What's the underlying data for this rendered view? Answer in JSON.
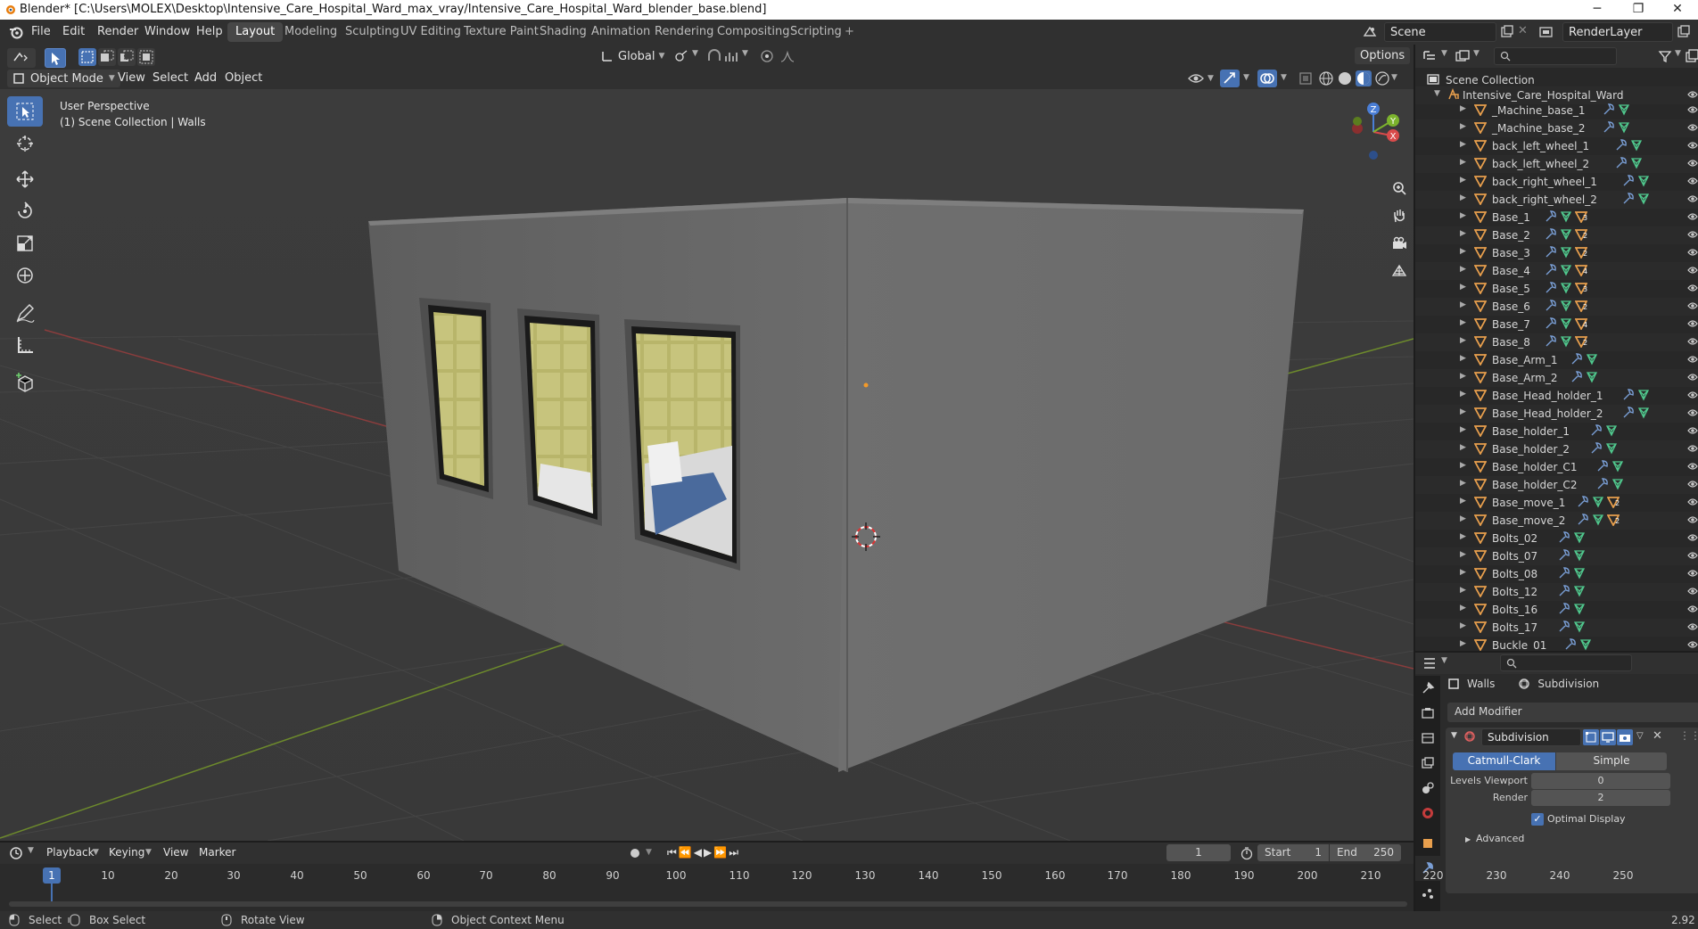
{
  "titlebar": {
    "title": "Blender* [C:\\Users\\MOLEX\\Desktop\\Intensive_Care_Hospital_Ward_max_vray/Intensive_Care_Hospital_Ward_blender_base.blend]",
    "minimize": "─",
    "maximize": "❐",
    "close": "✕"
  },
  "menus": [
    "File",
    "Edit",
    "Render",
    "Window",
    "Help"
  ],
  "workspaces": [
    "Layout",
    "Modeling",
    "Sculpting",
    "UV Editing",
    "Texture Paint",
    "Shading",
    "Animation",
    "Rendering",
    "Compositing",
    "Scripting"
  ],
  "active_workspace": "Layout",
  "add_workspace": "+",
  "scene": {
    "label": "Scene",
    "render_layer": "RenderLayer"
  },
  "viewport_header": {
    "mode": "Object Mode",
    "menus": [
      "View",
      "Select",
      "Add",
      "Object"
    ],
    "transform_orientation": "Global",
    "options": "Options"
  },
  "viewport": {
    "perspective": "User Perspective",
    "collection_info": "(1) Scene Collection | Walls"
  },
  "gizmo": {
    "x": "X",
    "y": "Y",
    "z": "Z"
  },
  "outliner": {
    "root": "Scene Collection",
    "collection": "Intensive_Care_Hospital_Ward",
    "items": [
      {
        "name": "_Machine_base_1",
        "badge": ""
      },
      {
        "name": "_Machine_base_2",
        "badge": ""
      },
      {
        "name": "back_left_wheel_1",
        "badge": ""
      },
      {
        "name": "back_left_wheel_2",
        "badge": ""
      },
      {
        "name": "back_right_wheel_1",
        "badge": ""
      },
      {
        "name": "back_right_wheel_2",
        "badge": ""
      },
      {
        "name": "Base_1",
        "badge": "3"
      },
      {
        "name": "Base_2",
        "badge": "2"
      },
      {
        "name": "Base_3",
        "badge": "2"
      },
      {
        "name": "Base_4",
        "badge": "4"
      },
      {
        "name": "Base_5",
        "badge": "3"
      },
      {
        "name": "Base_6",
        "badge": "2"
      },
      {
        "name": "Base_7",
        "badge": "4"
      },
      {
        "name": "Base_8",
        "badge": "2"
      },
      {
        "name": "Base_Arm_1",
        "badge": ""
      },
      {
        "name": "Base_Arm_2",
        "badge": ""
      },
      {
        "name": "Base_Head_holder_1",
        "badge": ""
      },
      {
        "name": "Base_Head_holder_2",
        "badge": ""
      },
      {
        "name": "Base_holder_1",
        "badge": ""
      },
      {
        "name": "Base_holder_2",
        "badge": ""
      },
      {
        "name": "Base_holder_C1",
        "badge": ""
      },
      {
        "name": "Base_holder_C2",
        "badge": ""
      },
      {
        "name": "Base_move_1",
        "badge": "2"
      },
      {
        "name": "Base_move_2",
        "badge": "2"
      },
      {
        "name": "Bolts_02",
        "badge": ""
      },
      {
        "name": "Bolts_07",
        "badge": ""
      },
      {
        "name": "Bolts_08",
        "badge": ""
      },
      {
        "name": "Bolts_12",
        "badge": ""
      },
      {
        "name": "Bolts_16",
        "badge": ""
      },
      {
        "name": "Bolts_17",
        "badge": ""
      },
      {
        "name": "Buckle_01",
        "badge": ""
      }
    ]
  },
  "properties": {
    "object": "Walls",
    "modifier_crumb": "Subdivision",
    "add_modifier": "Add Modifier",
    "modifier_name": "Subdivision",
    "types": [
      "Catmull-Clark",
      "Simple"
    ],
    "active_type": "Catmull-Clark",
    "levels_viewport_label": "Levels Viewport",
    "levels_viewport": "0",
    "render_label": "Render",
    "render": "2",
    "optimal_display": "Optimal Display",
    "optimal_checked": true,
    "advanced": "Advanced"
  },
  "timeline": {
    "menus": [
      "Playback",
      "Keying",
      "View",
      "Marker"
    ],
    "current_frame": "1",
    "start_label": "Start",
    "start": "1",
    "end_label": "End",
    "end": "250",
    "ticks": [
      "10",
      "20",
      "30",
      "40",
      "50",
      "60",
      "70",
      "80",
      "90",
      "100",
      "110",
      "120",
      "130",
      "140",
      "150",
      "160",
      "170",
      "180",
      "190",
      "200",
      "210",
      "220",
      "230",
      "240",
      "250"
    ],
    "playhead": "1"
  },
  "statusbar": {
    "select": "Select",
    "box_select": "Box Select",
    "rotate": "Rotate View",
    "context": "Object Context Menu",
    "version": "2.92"
  },
  "colors": {
    "accent": "#4772b3",
    "object_icon": "#e89f4d",
    "mesh_icon": "#50c98e",
    "modifier_icon": "#7a9fd6"
  }
}
